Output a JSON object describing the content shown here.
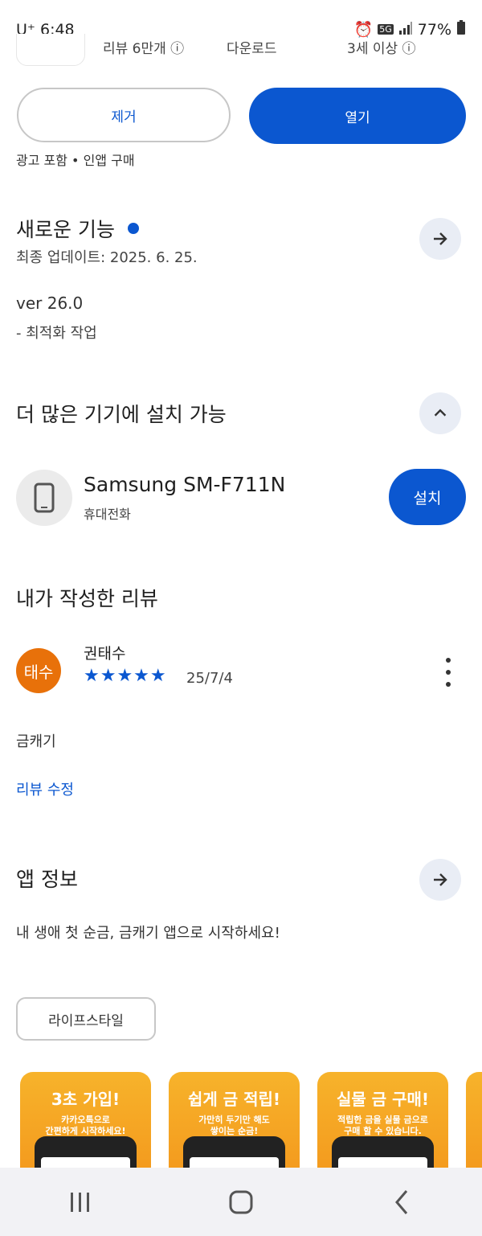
{
  "status_bar": {
    "carrier": "U⁺ 6:48",
    "network": "5G",
    "battery": "77%"
  },
  "partial_stats": [
    "리뷰 6만개 ⓘ",
    "다운로드",
    "3세 이상 ⓘ"
  ],
  "actions": {
    "remove_label": "제거",
    "open_label": "열기"
  },
  "ad_note": "광고 포함 • 인앱 구매",
  "whats_new": {
    "title": "새로운 기능",
    "updated": "최종 업데이트: 2025. 6. 25.",
    "version": "ver 26.0",
    "note": "- 최적화 작업"
  },
  "more_devices": {
    "title": "더 많은 기기에 설치 가능",
    "device_name": "Samsung SM-F711N",
    "device_type": "휴대전화",
    "install_label": "설치"
  },
  "my_review": {
    "title": "내가 작성한 리뷰",
    "avatar_text": "태수",
    "author": "권태수",
    "stars": "★★★★★",
    "rating": 5,
    "date": "25/7/4",
    "text": "금캐기",
    "edit_label": "리뷰 수정"
  },
  "app_info": {
    "title": "앱 정보",
    "description": "내 생애 첫 순금, 금캐기 앱으로 시작하세요!",
    "category": "라이프스타일"
  },
  "screenshots": [
    {
      "title": "3초 가입!",
      "subtitle": "카카오톡으로\n간편하게 시작하세요!"
    },
    {
      "title": "쉽게 금 적립!",
      "subtitle": "가만히 두기만 해도\n쌓이는 순금!"
    },
    {
      "title": "실물 금 구매!",
      "subtitle": "적립한 금을 실물 금으로\n구매 할 수 있습니다."
    }
  ],
  "colors": {
    "accent": "#0b57d0",
    "avatar": "#e8710a",
    "chip_border": "#c7c7c7"
  },
  "icons": [
    "arrow-right-icon",
    "chevron-up-icon",
    "phone-icon",
    "star-icon",
    "more-vert-icon",
    "recents-icon",
    "home-icon",
    "back-icon"
  ]
}
